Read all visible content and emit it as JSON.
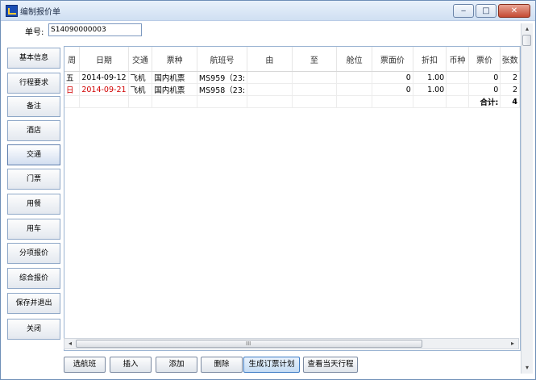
{
  "window": {
    "title": "编制报价单",
    "controls": {
      "minimize": "‒",
      "maximize": "□",
      "close": "✕"
    }
  },
  "order": {
    "label": "单号:",
    "value": "S14090000003"
  },
  "sidebar": {
    "items": [
      {
        "label": "基本信息"
      },
      {
        "label": "行程要求"
      },
      {
        "label": "备注"
      },
      {
        "label": "酒店"
      },
      {
        "label": "交通"
      },
      {
        "label": "门票"
      },
      {
        "label": "用餐"
      },
      {
        "label": "用车"
      },
      {
        "label": "分项报价"
      },
      {
        "label": "综合报价"
      },
      {
        "label": "保存并退出"
      },
      {
        "label": "关闭"
      }
    ],
    "active_index": 4
  },
  "grid": {
    "columns": [
      "周",
      "日期",
      "交通",
      "票种",
      "航班号",
      "由",
      "至",
      "舱位",
      "票面价",
      "折扣",
      "币种",
      "票价",
      "张数"
    ],
    "rows": [
      {
        "week": "五",
        "date": "2014-09-12",
        "transport": "飞机",
        "ticket_type": "国内机票",
        "flight": "MS959（23:",
        "from": "",
        "to": "",
        "cabin": "",
        "face_price": "0",
        "discount": "1.00",
        "currency": "",
        "price": "0",
        "count": "2",
        "highlight": false
      },
      {
        "week": "日",
        "date": "2014-09-21",
        "transport": "飞机",
        "ticket_type": "国内机票",
        "flight": "MS958（23:",
        "from": "",
        "to": "",
        "cabin": "",
        "face_price": "0",
        "discount": "1.00",
        "currency": "",
        "price": "0",
        "count": "2",
        "highlight": true
      }
    ],
    "total_label": "合计:",
    "total_count": "4"
  },
  "scroll": {
    "grip": "III",
    "left": "◂",
    "right": "▸",
    "up": "▴",
    "down": "▾"
  },
  "buttons": [
    {
      "label": "选航班"
    },
    {
      "label": "插入"
    },
    {
      "label": "添加"
    },
    {
      "label": "删除"
    },
    {
      "label": "生成订票计划"
    },
    {
      "label": "查看当天行程"
    }
  ],
  "colors": {
    "highlight_text": "#d10000",
    "frame_border": "#9bb4d2",
    "title_gradient": "#cfdff2"
  }
}
